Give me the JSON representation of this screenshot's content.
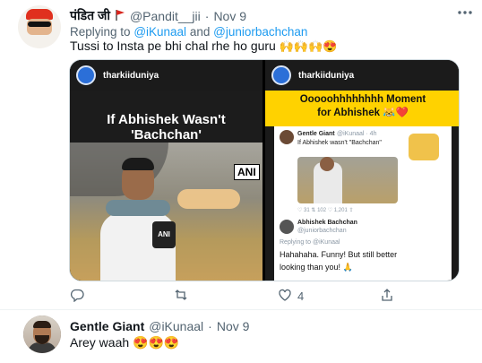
{
  "tweet1": {
    "display_name": "पंडित जी",
    "flag_icon": "pennant-flag-icon",
    "handle": "@Pandit__jii",
    "separator": "·",
    "date": "Nov 9",
    "more_icon": "more-dots-icon",
    "replying_prefix": "Replying to",
    "reply_to_1": "@iKunaal",
    "reply_and": "and",
    "reply_to_2": "@juniorbachchan",
    "text": "Tussi to Insta pe bhi chal rhe ho guru",
    "text_emoji": "🙌🙌🙌😍",
    "media": {
      "left": {
        "account": "tharkiiduniya",
        "title": "If Abhishek Wasn't 'Bachchan'",
        "watermark": "ANI",
        "mic_label": "ANI"
      },
      "right": {
        "account": "tharkiiduniya",
        "banner_line_1": "Ooooohhhhhhhh Moment",
        "banner_line_2": "for Abhishek 😹❤️",
        "embed_name": "Gentle Giant",
        "embed_handle": "@iKunaal · 4h",
        "embed_text": "If Abhishek wasn't \"Bachchan\"",
        "embed_stats": "♡ 31   ⇅ 102   ♡ 1,201   ⇪",
        "reply_name": "Abhishek Bachchan",
        "reply_handle": "@juniorbachchan",
        "replying_to": "Replying to @iKunaal",
        "reply_text_1": "Hahahaha. Funny! But still better",
        "reply_text_2": "looking than you! 🙏"
      }
    },
    "actions": {
      "reply_icon": "reply-bubble-icon",
      "retweet_icon": "retweet-icon",
      "like_icon": "heart-icon",
      "like_count": "4",
      "share_icon": "share-icon"
    }
  },
  "tweet2": {
    "display_name": "Gentle Giant",
    "handle": "@iKunaal",
    "separator": "·",
    "date": "Nov 9",
    "text": "Arey waah",
    "text_emoji": "😍😍😍"
  },
  "colors": {
    "link": "#1d9bf0",
    "muted": "#536471",
    "banner_yellow": "#ffd200"
  }
}
